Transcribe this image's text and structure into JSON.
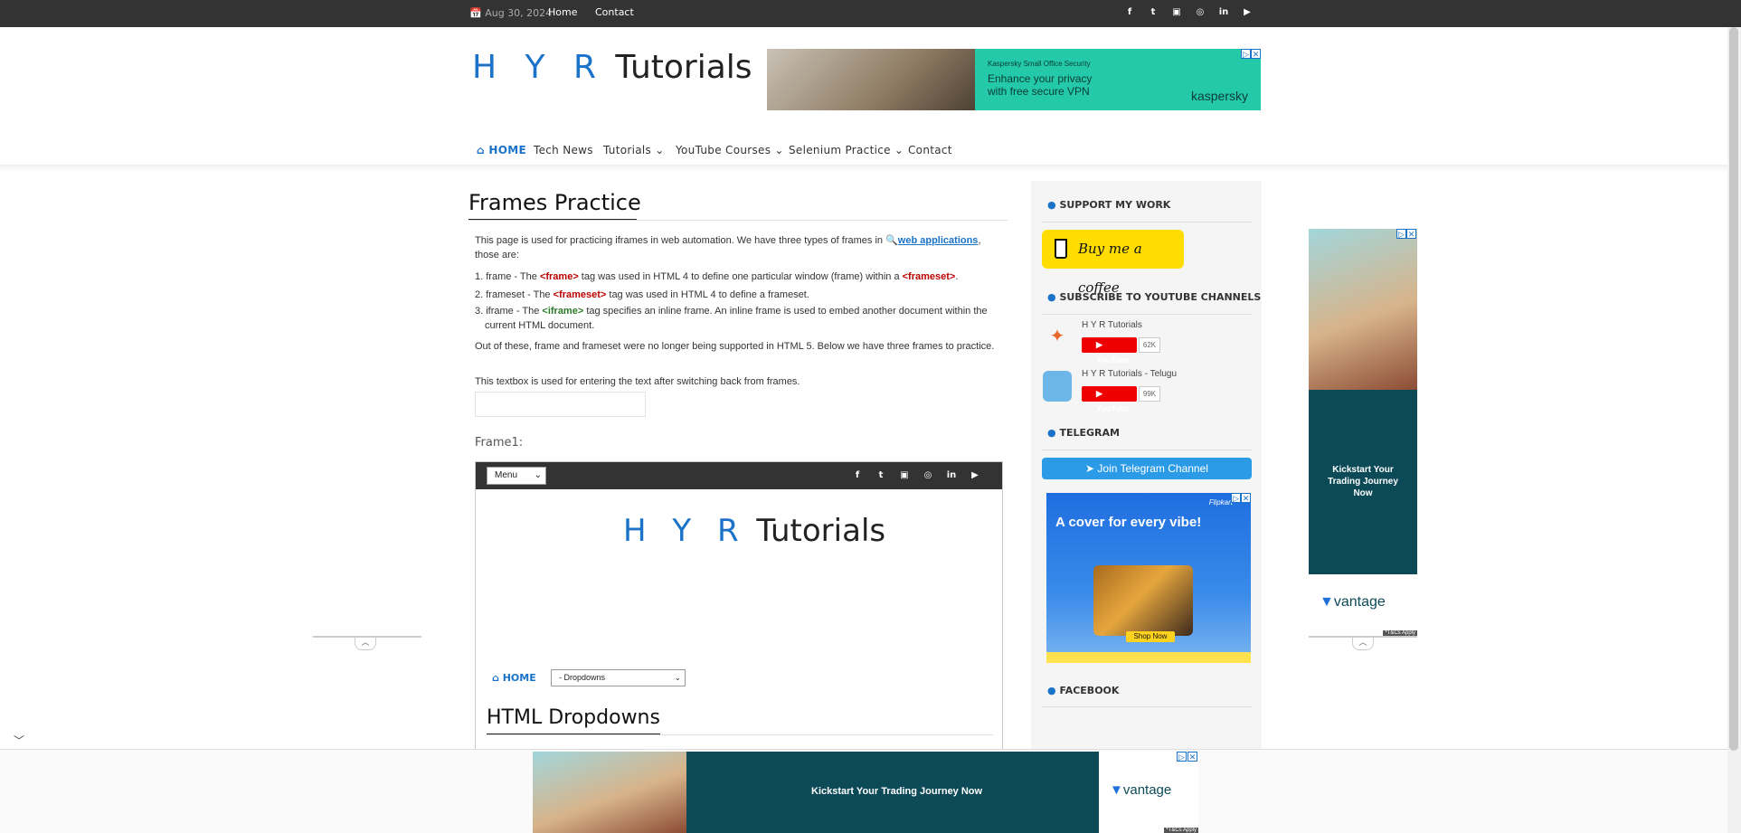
{
  "topbar": {
    "date": "Aug 30, 2024",
    "home": "Home",
    "contact": "Contact",
    "social": [
      "f",
      "t",
      "▣",
      "◎",
      "in",
      "▶"
    ]
  },
  "logo": {
    "hyr": "H Y R",
    "tutorials": "Tutorials"
  },
  "ad_top": {
    "small": "Kaspersky Small Office Security",
    "headline": "Enhance your privacy with free secure VPN",
    "brand": "kaspersky"
  },
  "nav": {
    "home": "HOME",
    "tech_news": "Tech News",
    "tutorials": "Tutorials",
    "youtube": "YouTube Courses",
    "selenium": "Selenium Practice",
    "contact": "Contact"
  },
  "main": {
    "title": "Frames Practice",
    "intro_1": "This page is used for practicing iframes in web automation. We have three types of frames in",
    "intro_link": "web applications",
    "intro_2": ", those are:",
    "item1_pre": "1. frame - The ",
    "item1_tag": "<frame>",
    "item1_mid": " tag was used in HTML 4 to define one particular window (frame) within a ",
    "item1_tag2": "<frameset>",
    "item1_end": ".",
    "item2_pre": "2. frameset - The ",
    "item2_tag": "<frameset>",
    "item2_end": " tag was used in HTML 4 to define a frameset.",
    "item3_pre": "3. iframe - The ",
    "item3_tag": "<iframe>",
    "item3_end": " tag specifies an inline frame. An inline frame is used to embed another document within the current HTML document.",
    "outro": "Out of these, frame and frameset were no longer being supported in HTML 5. Below we have three frames to practice.",
    "textbox_label": "This textbox is used for entering the text after switching back from frames.",
    "textbox_value": "",
    "frame1_label": "Frame1:"
  },
  "frame1": {
    "menu": "Menu",
    "logo_hyr": "H Y R",
    "logo_tut": "Tutorials",
    "home": "HOME",
    "dropdown": "- Dropdowns",
    "heading": "HTML Dropdowns"
  },
  "sidebar": {
    "support": "SUPPORT MY WORK",
    "coffee": "Buy me a coffee",
    "subscribe": "SUBSCRIBE TO YOUTUBE CHANNELS",
    "channels": [
      {
        "name": "H Y R Tutorials",
        "button": "YouTube",
        "count": "62K"
      },
      {
        "name": "H Y R Tutorials - Telugu",
        "button": "YouTube",
        "count": "99K"
      }
    ],
    "telegram": "TELEGRAM",
    "telegram_btn": "Join Telegram Channel",
    "ad_flipkart": {
      "brand": "Flipkart",
      "headline": "A cover for every vibe!",
      "shop": "Shop Now"
    },
    "facebook": "FACEBOOK"
  },
  "ad_sky": {
    "headline": "Kickstart Your Trading Journey Now",
    "brand": "vantage",
    "tc": "*T&Cs Apply"
  },
  "ad_bottom": {
    "headline": "Kickstart Your Trading Journey Now",
    "brand": "vantage",
    "tc": "*T&Cs Apply"
  }
}
